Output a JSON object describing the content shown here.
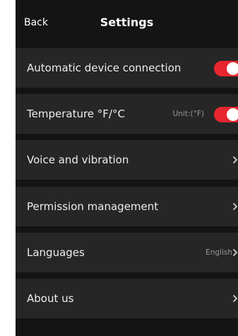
{
  "header": {
    "back_label": "Back",
    "title": "Settings"
  },
  "colors": {
    "background": "#141414",
    "row": "#262626",
    "accent": "#e8262e",
    "text": "#ededed",
    "muted": "#9a9a9a"
  },
  "rows": [
    {
      "label": "Automatic device connection",
      "control": "toggle",
      "toggle_on": true
    },
    {
      "label": "Temperature °F/°C",
      "value": "Unit:(°F)",
      "control": "toggle",
      "toggle_on": true
    },
    {
      "label": "Voice and vibration",
      "control": "chevron",
      "icon": "chevron-right-icon"
    },
    {
      "label": "Permission management",
      "control": "chevron",
      "icon": "chevron-right-icon"
    },
    {
      "label": "Languages",
      "value": "English",
      "control": "chevron",
      "icon": "chevron-right-icon"
    },
    {
      "label": "About us",
      "control": "chevron",
      "icon": "chevron-right-icon"
    }
  ]
}
